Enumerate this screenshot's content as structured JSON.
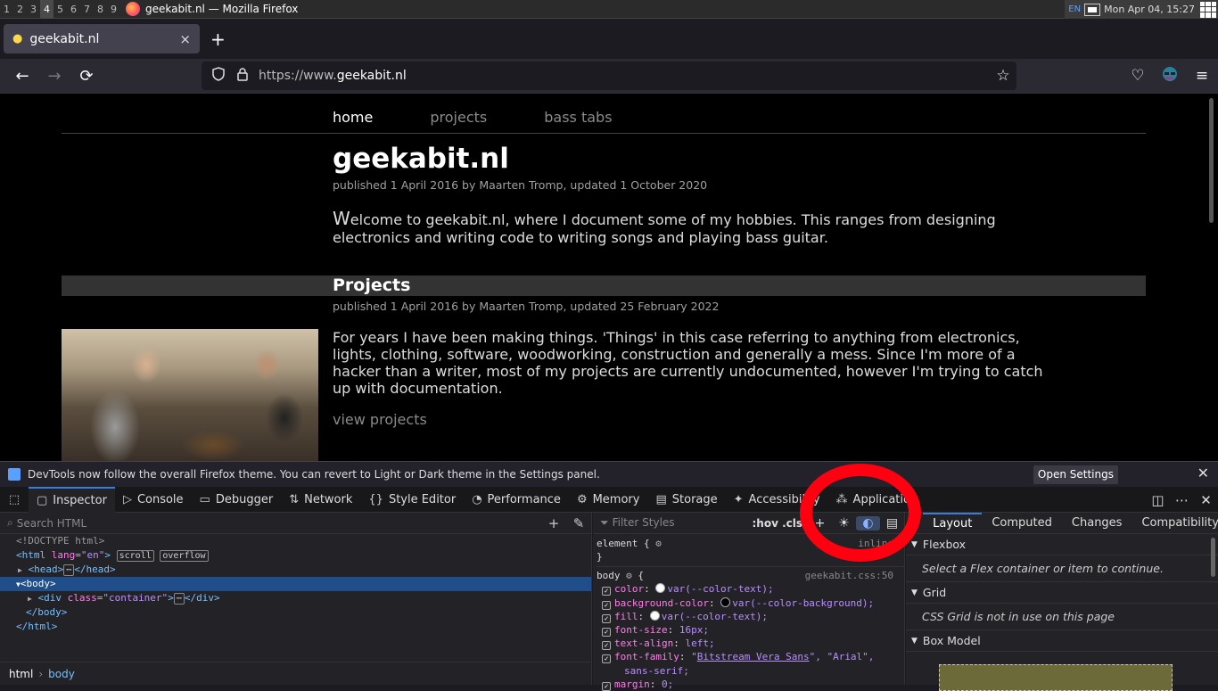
{
  "sysbar": {
    "workspaces": [
      "1",
      "2",
      "3",
      "4",
      "5",
      "6",
      "7",
      "8",
      "9"
    ],
    "active_workspace": "4",
    "window_title": "geekabit.nl — Mozilla Firefox",
    "kb_layout": "EN",
    "clock": "Mon Apr 04, 15:27"
  },
  "tab": {
    "label": "geekabit.nl",
    "close": "×",
    "new_tab": "+"
  },
  "nav": {
    "back": "←",
    "forward": "→",
    "reload": "⟳",
    "url_prefix": "https://www.",
    "url_domain": "geekabit.nl",
    "star": "☆",
    "pocket": "♡",
    "menu": "≡"
  },
  "page": {
    "nav_items": [
      "home",
      "projects",
      "bass tabs"
    ],
    "title": "geekabit.nl",
    "title_meta": "published 1 April 2016 by Maarten Tromp, updated 1 October 2020",
    "intro_cap": "W",
    "intro_rest": "elcome to geekabit.nl, where I document some of my hobbies. This ranges from designing electronics and writing code to writing songs and playing bass guitar.",
    "projects_heading": "Projects",
    "projects_meta": "published 1 April 2016 by Maarten Tromp, updated 25 February 2022",
    "projects_text": "For years I have been making things. 'Things' in this case referring to anything from electronics, lights, clothing, software, woodworking, construction and generally a mess. Since I'm more of a hacker than a writer, most of my projects are currently undocumented, however I'm trying to catch up with documentation.",
    "view_projects": "view projects"
  },
  "notice": {
    "text": "DevTools now follow the overall Firefox theme. You can revert to Light or Dark theme in the Settings panel.",
    "button": "Open Settings",
    "close": "✕"
  },
  "devtools": {
    "tabs": [
      "Inspector",
      "Console",
      "Debugger",
      "Network",
      "Style Editor",
      "Performance",
      "Memory",
      "Storage",
      "Accessibility",
      "Application"
    ],
    "tab_icons": [
      "▢",
      "▷",
      "▭",
      "⇅",
      "{}",
      "◔",
      "⚙",
      "▤",
      "✦",
      "⁂"
    ],
    "selected_tab": "Inspector",
    "search_placeholder": "Search HTML",
    "filter_placeholder": "Filter Styles",
    "hov_cls": ":hov .cls",
    "breadcrumb": [
      "html",
      "body"
    ],
    "layout_tabs": [
      "Layout",
      "Computed",
      "Changes",
      "Compatibility"
    ],
    "flexbox": {
      "title": "Flexbox",
      "msg": "Select a Flex container or item to continue."
    },
    "grid": {
      "title": "Grid",
      "msg": "CSS Grid is not in use on this page"
    },
    "boxmodel": {
      "title": "Box Model"
    }
  },
  "html_tree": {
    "doctype": "<!DOCTYPE html>",
    "html_open": "<html",
    "html_lang_attr": "lang",
    "html_lang_val": "\"en\"",
    "badge_scroll": "scroll",
    "badge_overflow": "overflow",
    "head": "<head>",
    "head_close": "</head>",
    "body_open": "<body>",
    "div_open": "<div",
    "div_class_attr": "class",
    "div_class_val": "\"container\"",
    "div_close": "</div>",
    "body_close": "</body>",
    "html_close": "</html>"
  },
  "rules": {
    "element_sel": "element {",
    "element_src": "inline",
    "close": "}",
    "body_sel": "body",
    "body_src": "geekabit.css:50",
    "decls": [
      {
        "prop": "color",
        "val": "var(--color-text);",
        "swatch": "#fbfbfe"
      },
      {
        "prop": "background-color",
        "val": "var(--color-background);",
        "swatch": "#000000"
      },
      {
        "prop": "fill",
        "val": "var(--color-text);",
        "swatch": "#fbfbfe"
      },
      {
        "prop": "font-size",
        "val": "16px;"
      },
      {
        "prop": "text-align",
        "val": "left;"
      }
    ],
    "ff_prop": "font-family",
    "ff_v1": "\"",
    "ff_link": "Bitstream Vera Sans",
    "ff_v2": "\", \"Arial\",",
    "ff_v3": "sans-serif;",
    "margin_prop": "margin",
    "margin_val": "0;"
  },
  "colors": {
    "accent": "#3b7cd9",
    "annotation": "#ff0010",
    "selected_row": "#204e8a"
  }
}
